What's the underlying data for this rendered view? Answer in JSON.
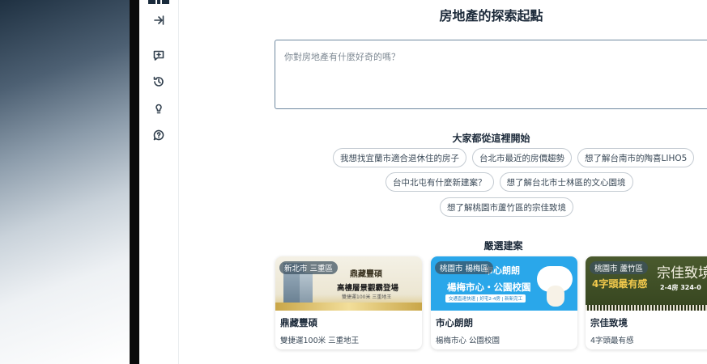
{
  "colors": {
    "accent": "#1a2b3c",
    "border": "#6f89a0",
    "chip_border": "#c4cbd2"
  },
  "rail": {
    "icons": [
      "logo-mark",
      "expand-sidebar-icon",
      "new-chat-icon",
      "history-icon",
      "lightbulb-icon",
      "help-icon"
    ]
  },
  "header": {
    "title": "房地產的探索起點"
  },
  "search": {
    "placeholder": "你對房地產有什麼好奇的嗎？"
  },
  "suggestions": {
    "title": "大家都從這裡開始",
    "rows": [
      [
        "我想找宜蘭市適合退休住的房子",
        "台北市最近的房價趨勢",
        "想了解台南市的陶喜LIHO5"
      ],
      [
        "台中北屯有什麼新建案？",
        "想了解台北市士林區的文心園境"
      ],
      [
        "想了解桃園市蘆竹區的宗佳致境"
      ]
    ]
  },
  "featured": {
    "title": "嚴選建案",
    "cards": [
      {
        "tag": "新北市 三重區",
        "name": "鼎藏豐碩",
        "desc": "雙捷運100米 三重地王",
        "banner": {
          "brand": "鼎藏豐碩",
          "headline": "高樓層景觀霸登場",
          "sub": "雙捷運100米 三重地王"
        }
      },
      {
        "tag": "桃園市 楊梅區",
        "name": "市心朗朗",
        "desc": "楊梅市心 公園校園",
        "banner": {
          "brand": "市心朗朗",
          "headline": "楊梅市心・公園校園",
          "sub": "交通直達快速 | 好宅2-4房 | 新新完工"
        }
      },
      {
        "tag": "桃園市 蘆竹區",
        "name": "宗佳致境",
        "desc": "4字頭最有感",
        "banner": {
          "brand": "宗佳致境",
          "headline": "4字頭最有感",
          "sub": "2-4房 324-0"
        }
      }
    ]
  }
}
